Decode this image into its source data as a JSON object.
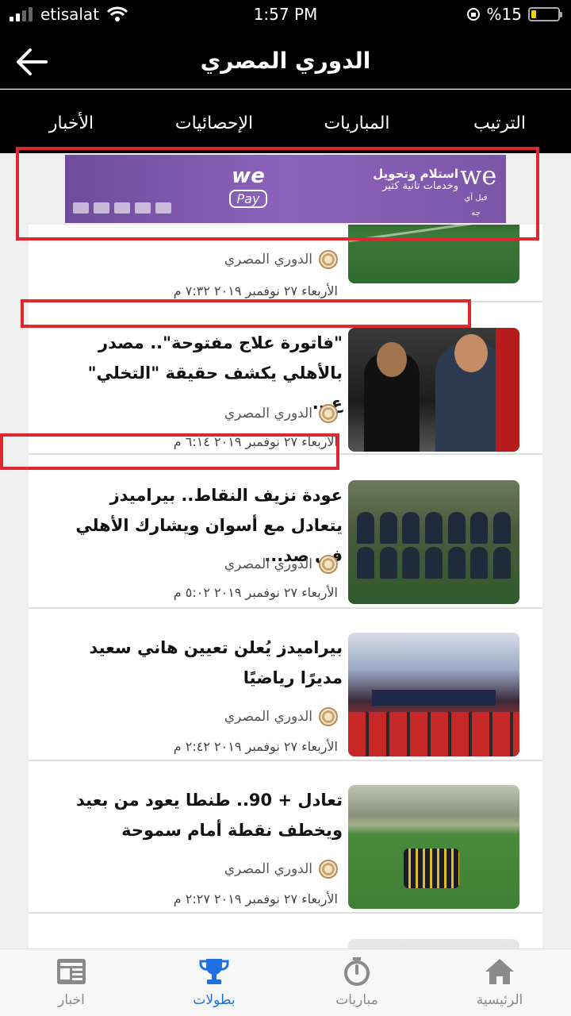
{
  "status_bar": {
    "carrier": "etisalat",
    "time": "1:57 PM",
    "battery": "%15"
  },
  "header": {
    "title": "الدوري المصري"
  },
  "tabs": [
    "الترتيب",
    "المباريات",
    "الإحصائيات",
    "الأخبار"
  ],
  "ad": {
    "brand": "we",
    "brand_sub": "فيل آي جه",
    "pay_title": "we",
    "pay_label": "Pay",
    "line1": "استلام وتحويل",
    "line2": "وخدمات تانية كتير"
  },
  "articles": [
    {
      "headline": "",
      "source": "الدوري المصري",
      "date": "الأربعاء ٢٧ نوفمبر ٢٠١٩ ٧:٣٢ م"
    },
    {
      "headline": "\"فاتورة علاج مفتوحة\".. مصدر بالأهلي يكشف حقيقة \"التخلي\" ع...",
      "source": "الدوري المصري",
      "date": "الأربعاء ٢٧ نوفمبر ٢٠١٩ ٦:١٤ م"
    },
    {
      "headline": "عودة نزيف النقاط.. بيراميدز يتعادل مع أسوان ويشارك الأهلي في صد...",
      "source": "الدوري المصري",
      "date": "الأربعاء ٢٧ نوفمبر ٢٠١٩ ٥:٠٢ م"
    },
    {
      "headline": "بيراميدز يُعلن تعيين هاني سعيد مديرًا رياضيًا",
      "source": "الدوري المصري",
      "date": "الأربعاء ٢٧ نوفمبر ٢٠١٩ ٢:٤٢ م"
    },
    {
      "headline": "تعادل + 90.. طنطا يعود من بعيد ويخطف نقطة أمام سموحة",
      "source": "الدوري المصري",
      "date": "الأربعاء ٢٧ نوفمبر ٢٠١٩ ٢:٢٧ م"
    }
  ],
  "bottom_nav": [
    {
      "label": "اخبار",
      "icon": "news-icon",
      "active": false
    },
    {
      "label": "بطولات",
      "icon": "trophy-icon",
      "active": true
    },
    {
      "label": "مباريات",
      "icon": "stopwatch-icon",
      "active": false
    },
    {
      "label": "الرئيسية",
      "icon": "home-icon",
      "active": false
    }
  ],
  "colors": {
    "accent": "#1f6fe0",
    "header_bg": "#000000",
    "annotation": "#e0262e",
    "ad_purple": "#7b56a8"
  }
}
